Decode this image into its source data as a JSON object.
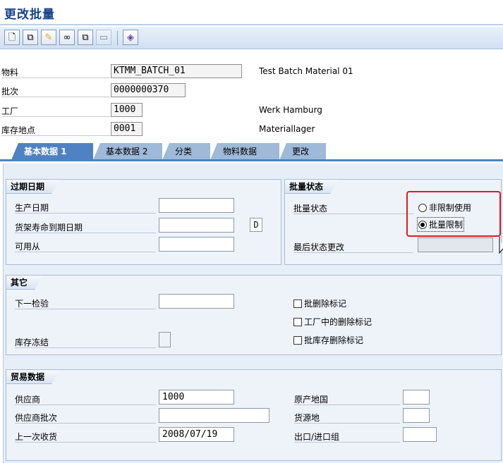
{
  "window": {
    "title": "更改批量"
  },
  "toolbar": {
    "buttons": [
      {
        "icon": "new-page-icon",
        "glyph": "🗋"
      },
      {
        "icon": "copy-icon",
        "glyph": "⧉"
      },
      {
        "icon": "edit-pencil-icon",
        "glyph": "✎"
      },
      {
        "icon": "glasses-display-icon",
        "glyph": "∞"
      },
      {
        "icon": "toggle-icon",
        "glyph": "⧉"
      },
      {
        "icon": "disabled-icon",
        "glyph": "▭"
      },
      {
        "icon": "eraser-icon",
        "glyph": "◈"
      }
    ]
  },
  "header": {
    "material_label": "物料",
    "material_value": "KTMM_BATCH_01",
    "material_desc": "Test Batch Material 01",
    "batch_label": "批次",
    "batch_value": "0000000370",
    "plant_label": "工厂",
    "plant_value": "1000",
    "plant_desc": "Werk Hamburg",
    "sloc_label": "库存地点",
    "sloc_value": "0001",
    "sloc_desc": "Materiallager"
  },
  "tabs": [
    {
      "label": "基本数据 1",
      "active": true
    },
    {
      "label": "基本数据 2",
      "active": false
    },
    {
      "label": "分类",
      "active": false
    },
    {
      "label": "物料数据",
      "active": false
    },
    {
      "label": "更改",
      "active": false
    }
  ],
  "expiry": {
    "title": "过期日期",
    "prod_date_label": "生产日期",
    "prod_date_value": "",
    "shelf_label": "货架寿命到期日期",
    "shelf_value": "",
    "shelf_unit": "D",
    "avail_label": "可用从",
    "avail_value": ""
  },
  "batch_status": {
    "title": "批量状态",
    "status_label": "批量状态",
    "option_unrestricted": "非限制使用",
    "option_restricted": "批量限制",
    "selected": "restricted",
    "last_change_label": "最后状态更改",
    "last_change_value": ""
  },
  "other": {
    "title": "其它",
    "next_insp_label": "下一检验",
    "next_insp_value": "",
    "stock_freeze_label": "库存冻结",
    "flag_batch_delete": "批删除标记",
    "flag_plant_delete": "工厂中的删除标记",
    "flag_sloc_delete": "批库存删除标记"
  },
  "trade": {
    "title": "贸易数据",
    "vendor_label": "供应商",
    "vendor_value": "1000",
    "vendor_batch_label": "供应商批次",
    "vendor_batch_value": "",
    "last_gr_label": "上一次收货",
    "last_gr_value": "2008/07/19",
    "origin_label": "原产地国",
    "origin_value": "",
    "source_label": "货源地",
    "source_value": "",
    "export_label": "出口/进口组",
    "export_value": ""
  }
}
